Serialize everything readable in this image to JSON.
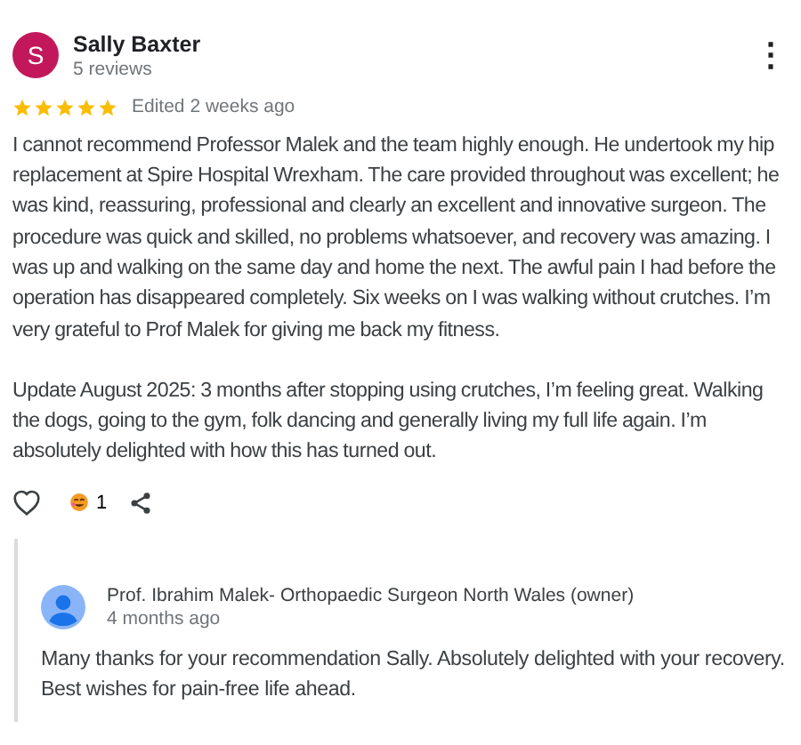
{
  "review": {
    "avatar_letter": "S",
    "author": "Sally Baxter",
    "review_count": "5 reviews",
    "more_icon": "⋮",
    "stars": 5,
    "time": "Edited 2 weeks ago",
    "paragraphs": [
      "I cannot recommend Professor Malek and the team highly enough. He undertook my hip replacement at Spire Hospital Wrexham. The care provided throughout was excellent; he was kind, reassuring, professional and clearly an excellent and innovative surgeon. The procedure was quick and skilled, no problems whatsoever, and recovery was amazing. I was up and walking on the same day and home the next. The awful pain I had before the operation has disappeared completely. Six weeks on I was walking without crutches. I’m very grateful to Prof Malek for giving me back my fitness.",
      "Update August 2025: 3 months after stopping using crutches, I’m feeling great. Walking the dogs, going to the gym, folk dancing and generally living my full life again. I’m absolutely delighted with how this has turned out."
    ],
    "liked": false,
    "reaction_count": "1"
  },
  "owner_reply": {
    "author": "Prof. Ibrahim Malek- Orthopaedic Surgeon North Wales (owner)",
    "time": "4 months ago",
    "text": "Many thanks for your recommendation Sally. Absolutely delighted with your recovery. Best wishes for pain-free life ahead."
  }
}
